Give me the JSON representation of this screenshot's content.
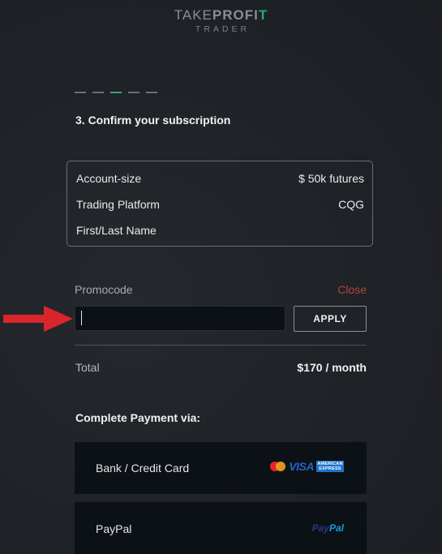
{
  "header": {
    "logo_take": "TAKE",
    "logo_profit": "PROFI",
    "logo_t": "T",
    "logo_sub": "TRADER"
  },
  "steps": {
    "total": 5,
    "active_index": 2
  },
  "step_title": "3. Confirm your subscription",
  "summary": {
    "rows": [
      {
        "label": "Account-size",
        "value": "$ 50k futures"
      },
      {
        "label": "Trading Platform",
        "value": "CQG"
      },
      {
        "label": "First/Last Name",
        "value": ""
      }
    ]
  },
  "promo": {
    "label": "Promocode",
    "close_label": "Close",
    "input_value": "",
    "apply_label": "APPLY"
  },
  "total": {
    "label": "Total",
    "value": "$170 / month"
  },
  "payment": {
    "title": "Complete Payment via:",
    "options": [
      {
        "label": "Bank / Credit Card",
        "visa_text": "VISA",
        "amex_line1": "AMERICAN",
        "amex_line2": "EXPRESS"
      },
      {
        "label": "PayPal",
        "logo_part1": "Pay",
        "logo_part2": "Pal"
      }
    ]
  },
  "colors": {
    "background": "#1e2126",
    "accent_green": "#2aa876",
    "close_red": "#b2453d",
    "annotation_arrow": "#d9262b",
    "panel_dark": "#0c1116"
  },
  "annotation": {
    "icon": "red-arrow-icon"
  }
}
